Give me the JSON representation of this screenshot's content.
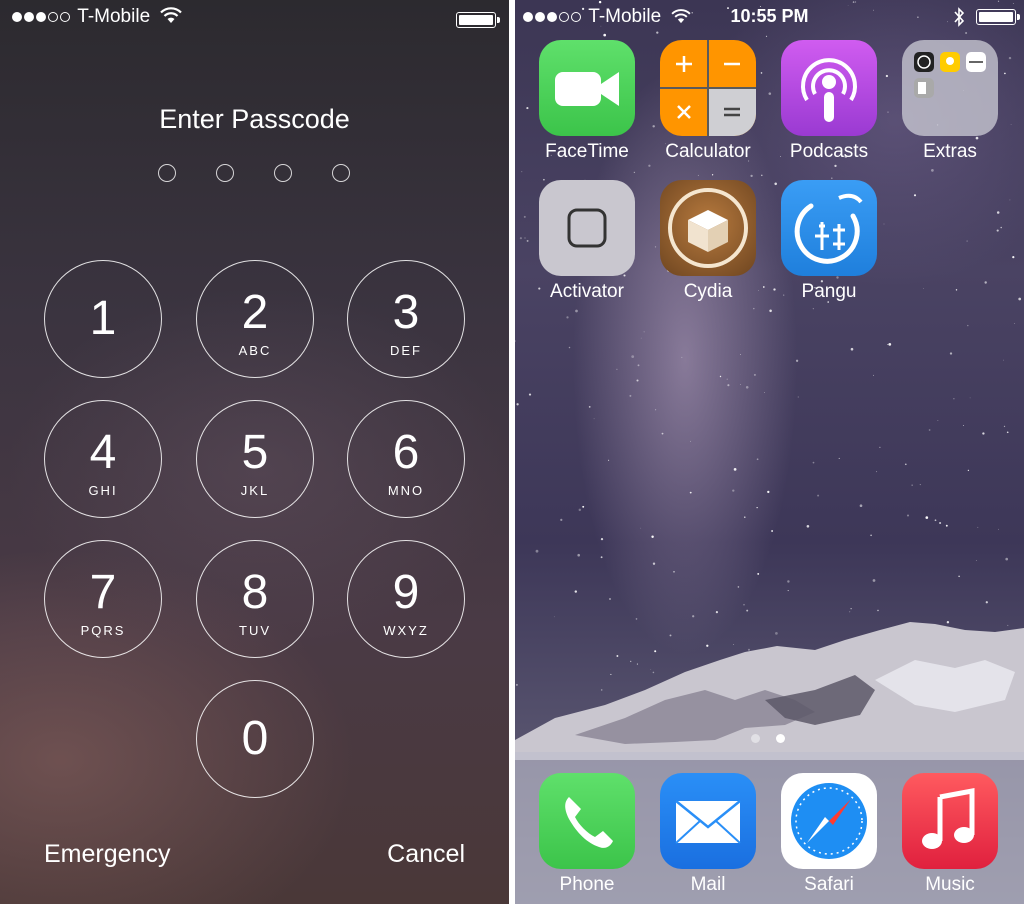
{
  "lock_screen": {
    "status": {
      "carrier": "T-Mobile",
      "signal_filled": 3,
      "signal_total": 5,
      "battery_level": 1.0
    },
    "title": "Enter Passcode",
    "passcode_length": 4,
    "keys": [
      {
        "digit": "1",
        "letters": ""
      },
      {
        "digit": "2",
        "letters": "ABC"
      },
      {
        "digit": "3",
        "letters": "DEF"
      },
      {
        "digit": "4",
        "letters": "GHI"
      },
      {
        "digit": "5",
        "letters": "JKL"
      },
      {
        "digit": "6",
        "letters": "MNO"
      },
      {
        "digit": "7",
        "letters": "PQRS"
      },
      {
        "digit": "8",
        "letters": "TUV"
      },
      {
        "digit": "9",
        "letters": "WXYZ"
      },
      {
        "digit": "0",
        "letters": ""
      }
    ],
    "emergency_label": "Emergency",
    "cancel_label": "Cancel"
  },
  "home_screen": {
    "status": {
      "carrier": "T-Mobile",
      "signal_filled": 3,
      "signal_total": 5,
      "time": "10:55 PM",
      "battery_level": 1.0,
      "bluetooth_icon": "bluetooth-icon"
    },
    "apps": [
      {
        "label": "FaceTime",
        "icon": "facetime-icon"
      },
      {
        "label": "Calculator",
        "icon": "calculator-icon"
      },
      {
        "label": "Podcasts",
        "icon": "podcasts-icon"
      },
      {
        "label": "Extras",
        "icon": "folder-icon"
      },
      {
        "label": "Activator",
        "icon": "activator-icon"
      },
      {
        "label": "Cydia",
        "icon": "cydia-icon"
      },
      {
        "label": "Pangu",
        "icon": "pangu-icon"
      }
    ],
    "page_count": 2,
    "current_page": 2,
    "dock": [
      {
        "label": "Phone",
        "icon": "phone-icon"
      },
      {
        "label": "Mail",
        "icon": "mail-icon"
      },
      {
        "label": "Safari",
        "icon": "safari-icon"
      },
      {
        "label": "Music",
        "icon": "music-icon"
      }
    ]
  },
  "colors": {
    "facetime_green": "#4cd964",
    "calculator_orange": "#ff9500",
    "podcasts_purple": "#b04ad8",
    "pangu_blue": "#2a8ff0",
    "cydia_brown": "#8a5a2b",
    "music_red": "#fc3158",
    "mail_blue": "#1e90ff"
  }
}
